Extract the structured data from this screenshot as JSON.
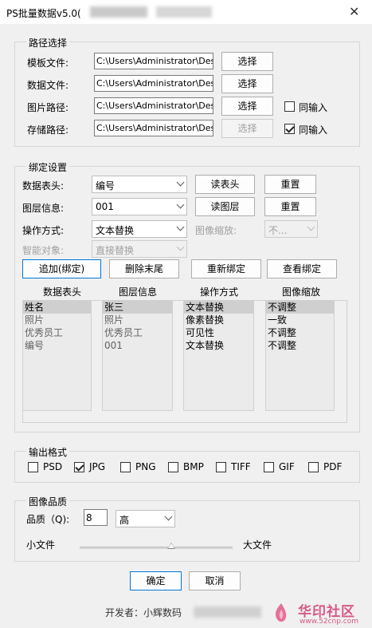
{
  "window": {
    "title": "PS批量数据v5.0(",
    "close_glyph": "✕"
  },
  "path_group": {
    "title": "路径选择",
    "rows": [
      {
        "label": "模板文件:",
        "value": "C:\\Users\\Administrator\\Des",
        "button": "选择"
      },
      {
        "label": "数据文件:",
        "value": "C:\\Users\\Administrator\\Des",
        "button": "选择"
      },
      {
        "label": "图片路径:",
        "value": "C:\\Users\\Administrator\\Des",
        "button": "选择",
        "check_label": "同输入",
        "checked": false
      },
      {
        "label": "存储路径:",
        "value": "C:\\Users\\Administrator\\Des",
        "button": "选择",
        "check_label": "同输入",
        "checked": true,
        "button_disabled": true
      }
    ]
  },
  "bind_group": {
    "title": "绑定设置",
    "data_header_label": "数据表头:",
    "data_header_value": "编号",
    "read_header_button": "读表头",
    "reset1": "重置",
    "layer_label": "图层信息:",
    "layer_value": "001",
    "read_layer_button": "读图层",
    "reset2": "重置",
    "op_label": "操作方式:",
    "op_value": "文本替换",
    "scale_label": "图像缩放:",
    "scale_value": "不...",
    "smart_label": "智能对象:",
    "smart_value": "直接替换",
    "add_bind": "追加(绑定)",
    "delete_tail": "删除末尾",
    "rebind": "重新绑定",
    "view_bind": "查看绑定",
    "columns": [
      "数据表头",
      "图层信息",
      "操作方式",
      "图像缩放"
    ],
    "list_headers": [
      "姓名",
      "照片",
      "优秀员工",
      "编号"
    ],
    "list_layers": [
      "张三",
      "照片",
      "优秀员工",
      "001"
    ],
    "list_ops": [
      "文本替换",
      "像素替换",
      "可见性",
      "文本替换"
    ],
    "list_scales": [
      "不调整",
      "一致",
      "不调整",
      "不调整"
    ]
  },
  "output_group": {
    "title": "输出格式",
    "formats": [
      {
        "label": "PSD",
        "checked": false
      },
      {
        "label": "JPG",
        "checked": true
      },
      {
        "label": "PNG",
        "checked": false
      },
      {
        "label": "BMP",
        "checked": false
      },
      {
        "label": "TIFF",
        "checked": false
      },
      {
        "label": "GIF",
        "checked": false
      },
      {
        "label": "PDF",
        "checked": false
      }
    ]
  },
  "quality_group": {
    "title": "图像品质",
    "quality_label": "品质（Q):",
    "quality_value": "8",
    "quality_level": "高",
    "small_label": "小文件",
    "large_label": "大文件",
    "slider_position": 0.6
  },
  "footer": {
    "ok": "确定",
    "cancel": "取消",
    "developer": "开发者：小辉数码",
    "watermark": "华印社区",
    "watermark_url": "www.52cnp.com"
  }
}
